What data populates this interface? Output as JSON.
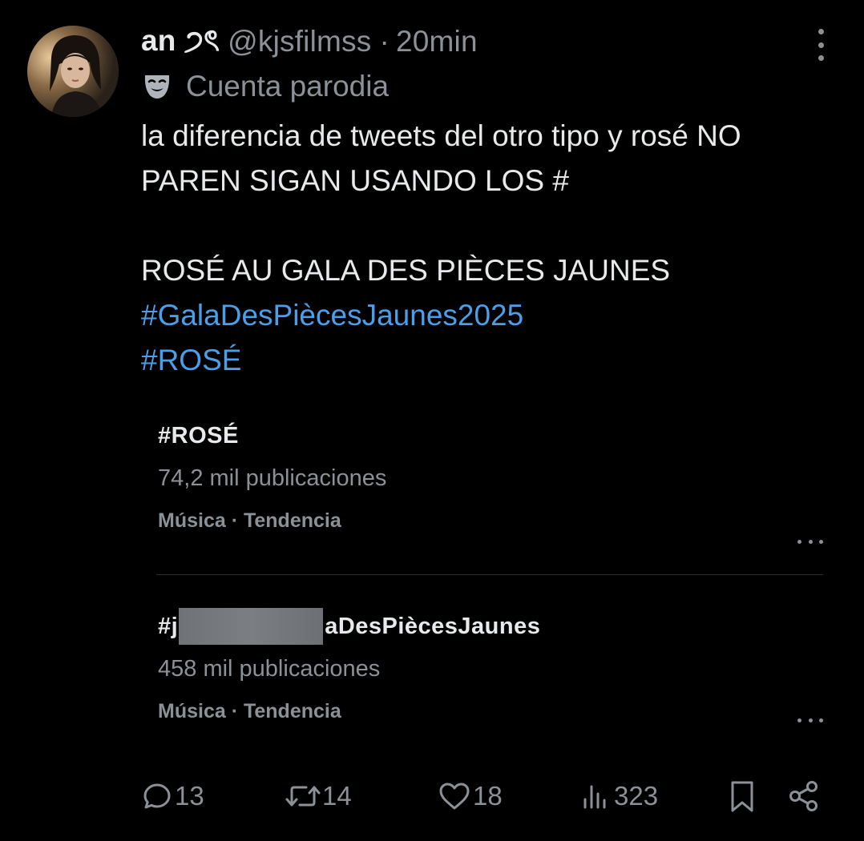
{
  "author": {
    "display_name": "an ੭ৎ",
    "handle": "@kjsfilmss",
    "separator": "·",
    "time": "20min",
    "label": "Cuenta parodia"
  },
  "tweet": {
    "lines": [
      "la diferencia de tweets del otro tipo y rosé NO",
      "PAREN SIGAN USANDO LOS #",
      "",
      "ROSÉ AU GALA DES PIÈCES JAUNES"
    ],
    "hashtags": [
      "#GalaDesPiècesJaunes2025",
      "#ROSÉ"
    ]
  },
  "trends": [
    {
      "title": "#ROSÉ",
      "count": "74,2 mil publicaciones",
      "meta": "Música · Tendencia"
    },
    {
      "title_prefix": "#j",
      "title_suffix": "aDesPiècesJaunes",
      "count": "458 mil publicaciones",
      "meta": "Música · Tendencia"
    }
  ],
  "actions": {
    "replies": "13",
    "reposts": "14",
    "likes": "18",
    "views": "323"
  },
  "colors": {
    "background": "#000000",
    "text": "#e7e9ea",
    "muted": "#8b9196",
    "link": "#4b9ee8"
  }
}
